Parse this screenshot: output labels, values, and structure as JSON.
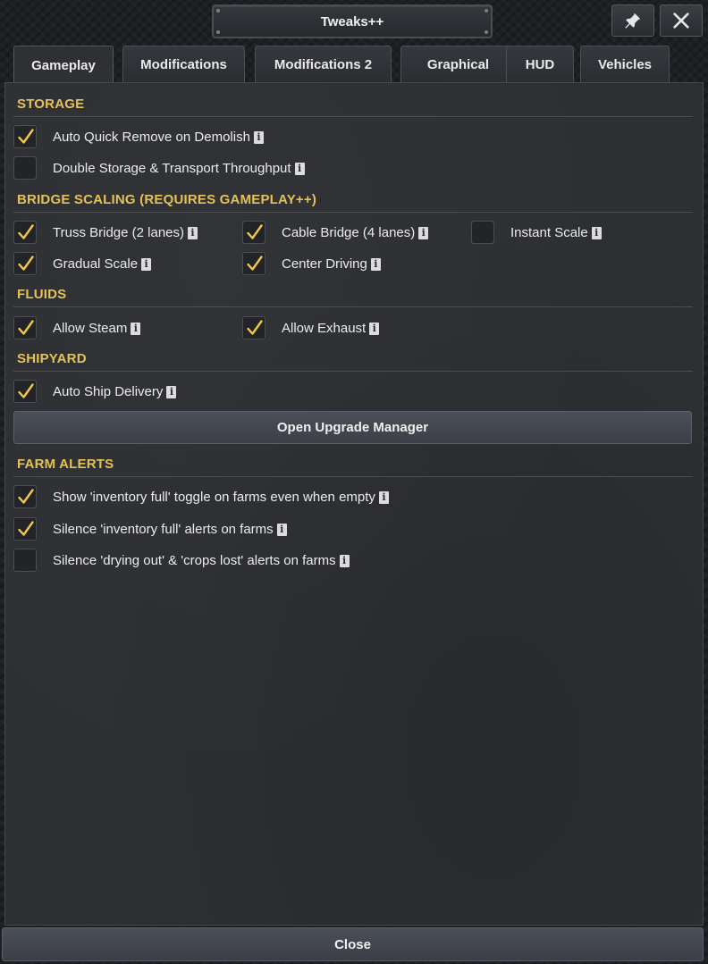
{
  "window": {
    "title": "Tweaks++"
  },
  "header": {
    "pin_icon": "pin-icon",
    "close_icon": "close-icon"
  },
  "tabs": [
    {
      "label": "Gameplay",
      "active": true
    },
    {
      "label": "Modifications"
    },
    {
      "label": "Modifications 2"
    },
    {
      "label": "Graphical"
    },
    {
      "label": "HUD"
    },
    {
      "label": "Vehicles"
    }
  ],
  "sections": {
    "storage": {
      "title": "STORAGE",
      "items": [
        {
          "label": "Auto Quick Remove on Demolish",
          "checked": true
        },
        {
          "label": "Double Storage & Transport Throughput",
          "checked": false
        }
      ]
    },
    "bridge": {
      "title": "BRIDGE SCALING (REQUIRES GAMEPLAY++)",
      "items": [
        {
          "label": "Truss Bridge (2 lanes)",
          "checked": true
        },
        {
          "label": "Cable Bridge (4 lanes)",
          "checked": true
        },
        {
          "label": "Instant Scale",
          "checked": false
        },
        {
          "label": "Gradual Scale",
          "checked": true
        },
        {
          "label": "Center Driving",
          "checked": true
        }
      ]
    },
    "fluids": {
      "title": "FLUIDS",
      "items": [
        {
          "label": "Allow Steam",
          "checked": true
        },
        {
          "label": "Allow Exhaust",
          "checked": true
        }
      ]
    },
    "shipyard": {
      "title": "SHIPYARD",
      "items": [
        {
          "label": "Auto Ship Delivery",
          "checked": true
        }
      ],
      "button_label": "Open Upgrade Manager"
    },
    "farm": {
      "title": "FARM ALERTS",
      "items": [
        {
          "label": "Show 'inventory full' toggle on farms even when empty",
          "checked": true
        },
        {
          "label": "Silence 'inventory full' alerts on farms",
          "checked": true
        },
        {
          "label": "Silence 'drying out' & 'crops lost' alerts on farms",
          "checked": false
        }
      ]
    }
  },
  "info_glyph": "i",
  "footer": {
    "close_label": "Close"
  },
  "colors": {
    "accent": "#e5c15a",
    "check": "#f2c94c",
    "panel": "#2d2f33"
  }
}
